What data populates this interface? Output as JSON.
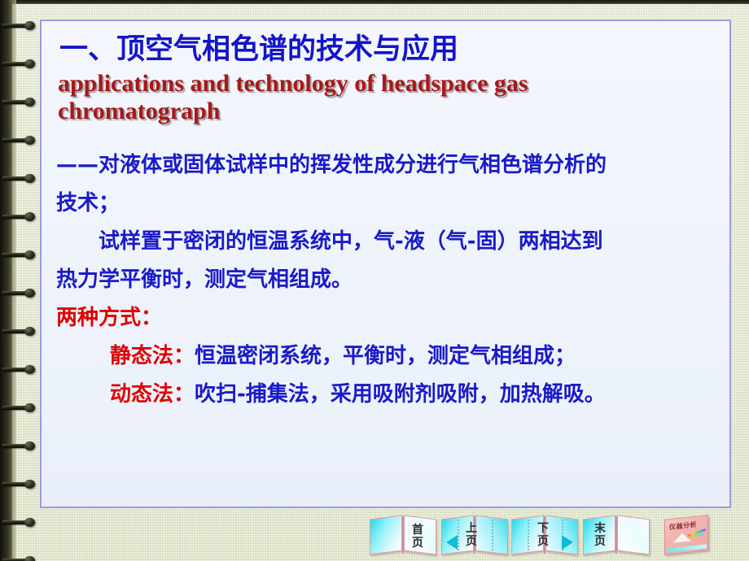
{
  "slide": {
    "title_cn": "一、顶空气相色谱的技术与应用",
    "title_en_line1": "applications and technology of headspace gas",
    "title_en_line2": "chromatograph",
    "body": [
      {
        "id": "def_line1",
        "text": "——对液体或固体试样中的挥发性成分进行气相色谱分析的",
        "style": "blue",
        "indent": false
      },
      {
        "id": "def_line2",
        "text": "技术；",
        "style": "blue",
        "indent": false
      },
      {
        "id": "desc_line1",
        "text": "试样置于密闭的恒温系统中，气-液（气-固）两相达到",
        "style": "blue",
        "indent": true
      },
      {
        "id": "desc_line2",
        "text": "热力学平衡时，测定气相组成。",
        "style": "blue",
        "indent": false
      },
      {
        "id": "methods_heading",
        "text": "两种方式：",
        "style": "red",
        "indent": false
      }
    ],
    "methods": [
      {
        "id": "static_method",
        "label": "静态法：",
        "detail": "恒温密闭系统，平衡时，测定气相组成；"
      },
      {
        "id": "dynamic_method",
        "label": "动态法：",
        "detail": "吹扫-捕集法，采用吸附剂吸附，加热解吸。"
      }
    ]
  },
  "nav": {
    "first_page": "首页",
    "prev_page": "上页",
    "next_page": "下页",
    "last_page": "末页",
    "book_title": "仪器分析"
  },
  "colors": {
    "title_blue": "#1414c8",
    "title_red": "#a81818",
    "body_blue": "#1a1ac8",
    "accent_red": "#e00000",
    "box_border": "#9a9ade",
    "box_fill": "#eef3fb",
    "page_bg": "#e4e9cd"
  }
}
